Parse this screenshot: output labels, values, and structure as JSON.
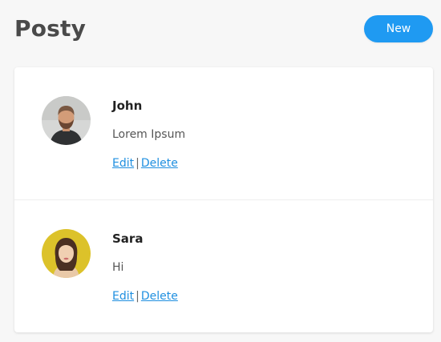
{
  "header": {
    "title": "Posty",
    "new_label": "New"
  },
  "posts": [
    {
      "author": "John",
      "body": "Lorem Ipsum",
      "edit_label": "Edit",
      "separator": "|",
      "delete_label": "Delete"
    },
    {
      "author": "Sara",
      "body": "Hi",
      "edit_label": "Edit",
      "separator": "|",
      "delete_label": "Delete"
    }
  ],
  "colors": {
    "accent": "#1f9af2",
    "link": "#1f8fe0",
    "background": "#f7f7f7"
  }
}
